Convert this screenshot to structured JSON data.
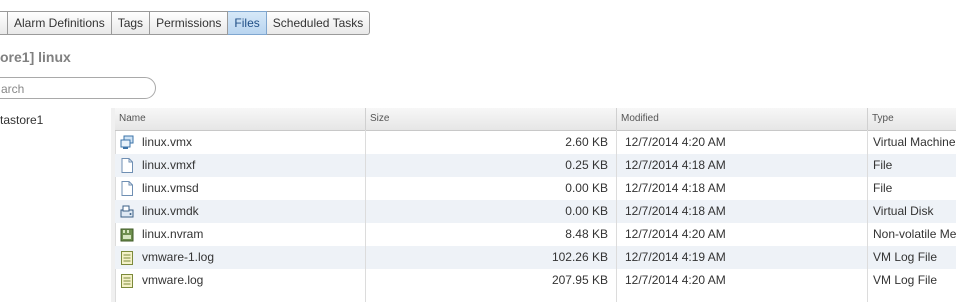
{
  "tabs": [
    {
      "label": ""
    },
    {
      "label": "Alarm Definitions"
    },
    {
      "label": "Tags"
    },
    {
      "label": "Permissions"
    },
    {
      "label": "Files",
      "active": true
    },
    {
      "label": "Scheduled Tasks"
    }
  ],
  "path_title": "ore1] linux",
  "search": {
    "placeholder": "arch",
    "icon": "search-icon"
  },
  "tree": {
    "item_label": "tastore1"
  },
  "columns": [
    "Name",
    "Size",
    "Modified",
    "Type"
  ],
  "files": [
    {
      "name": "linux.vmx",
      "size": "2.60 KB",
      "modified": "12/7/2014 4:20 AM",
      "type": "Virtual Machine",
      "icon": "vm-config-icon"
    },
    {
      "name": "linux.vmxf",
      "size": "0.25 KB",
      "modified": "12/7/2014 4:18 AM",
      "type": "File",
      "icon": "file-icon"
    },
    {
      "name": "linux.vmsd",
      "size": "0.00 KB",
      "modified": "12/7/2014 4:18 AM",
      "type": "File",
      "icon": "file-icon"
    },
    {
      "name": "linux.vmdk",
      "size": "0.00 KB",
      "modified": "12/7/2014 4:18 AM",
      "type": "Virtual Disk",
      "icon": "virtual-disk-icon"
    },
    {
      "name": "linux.nvram",
      "size": "8.48 KB",
      "modified": "12/7/2014 4:20 AM",
      "type": "Non-volatile Me",
      "icon": "nvram-icon"
    },
    {
      "name": "vmware-1.log",
      "size": "102.26 KB",
      "modified": "12/7/2014 4:19 AM",
      "type": "VM Log File",
      "icon": "log-file-icon"
    },
    {
      "name": "vmware.log",
      "size": "207.95 KB",
      "modified": "12/7/2014 4:20 AM",
      "type": "VM Log File",
      "icon": "log-file-icon"
    }
  ],
  "colors": {
    "active_tab": "#b9d5f0",
    "alt_row": "#eef2f7",
    "accent": "#1f4e86"
  }
}
